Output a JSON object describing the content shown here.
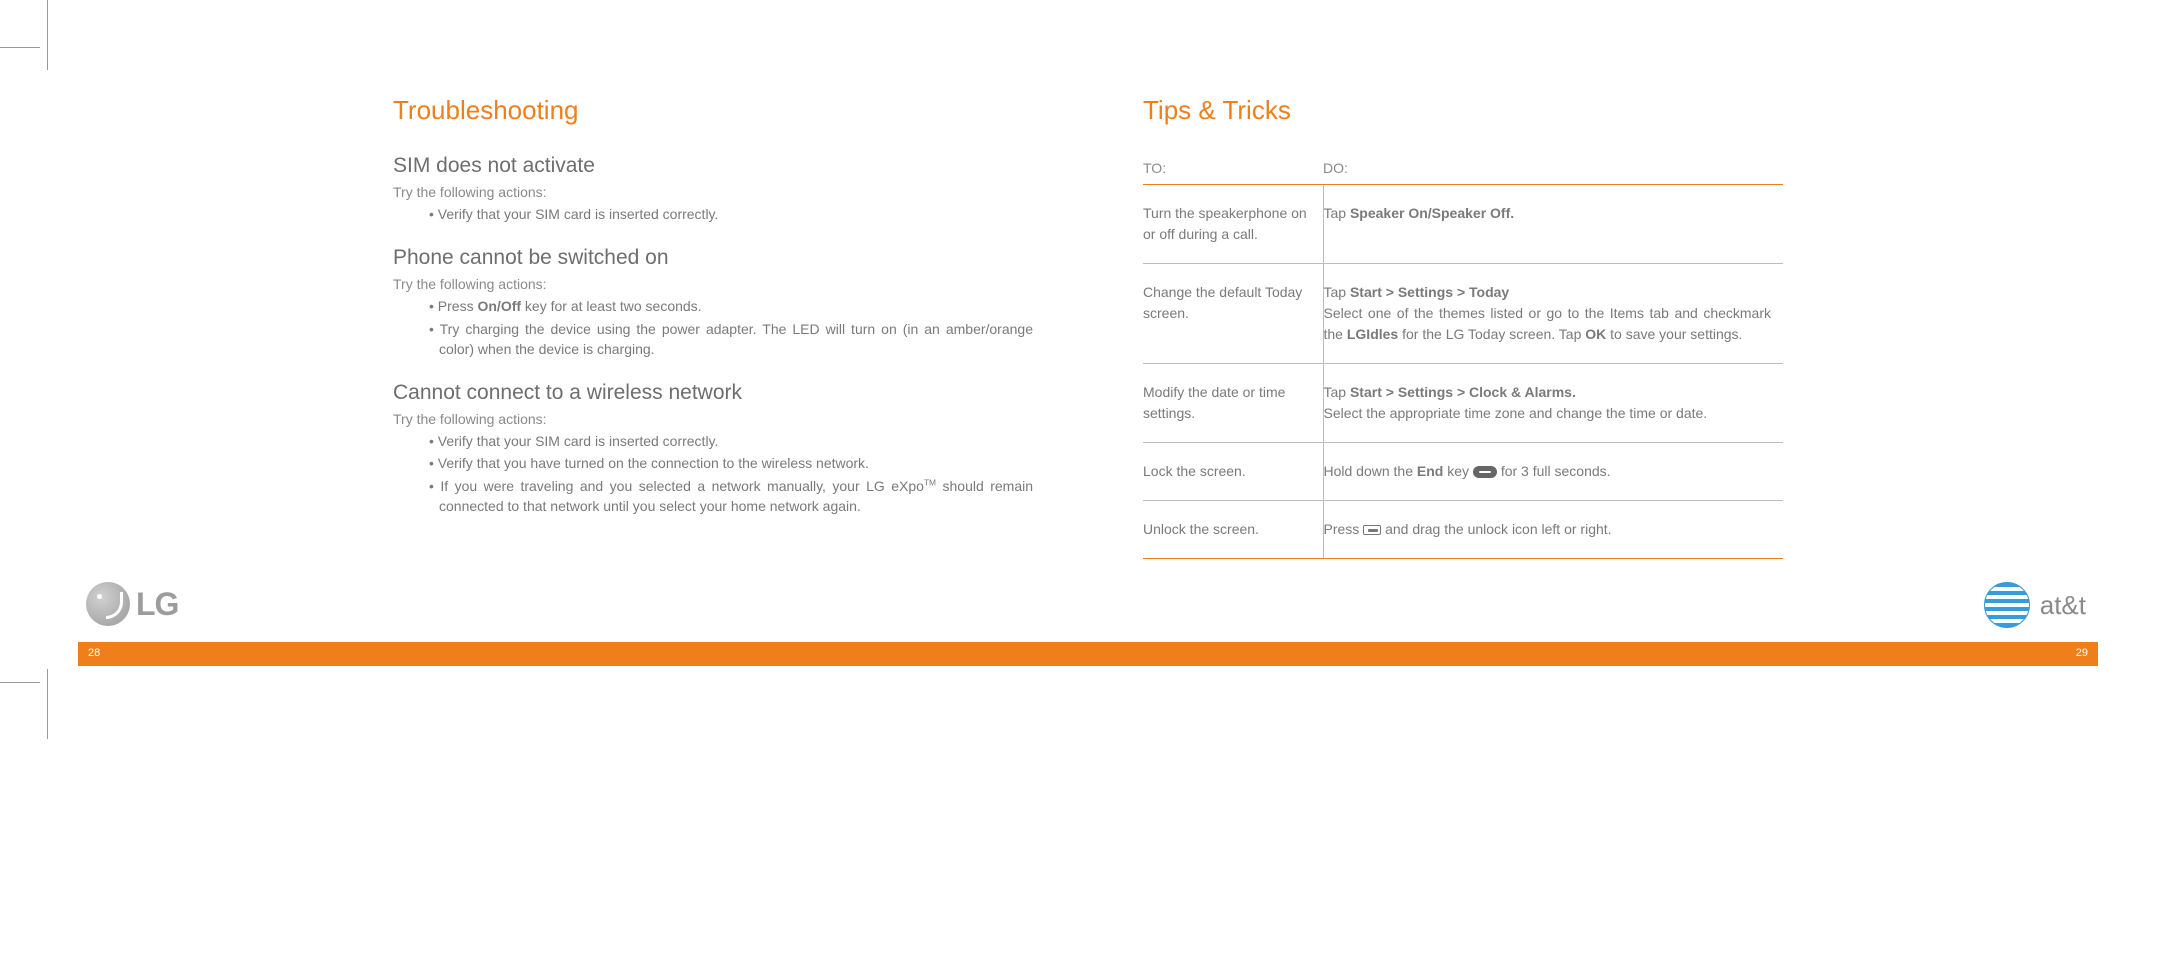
{
  "left": {
    "title": "Troubleshooting",
    "sections": [
      {
        "heading": "SIM does not activate",
        "intro": "Try the following actions:",
        "items": [
          "Verify that your SIM card is inserted correctly."
        ]
      },
      {
        "heading": "Phone cannot be switched on",
        "intro": "Try the following actions:",
        "items_html": [
          "Press <strong>On/Off</strong> key for at least two seconds.",
          "Try charging the device using the power adapter. The LED will turn on (in an amber/orange color) when the device is charging."
        ]
      },
      {
        "heading": "Cannot connect to a wireless network",
        "intro": "Try the following actions:",
        "items_html": [
          "Verify that your SIM card is inserted correctly.",
          "Verify that you have turned on the connection to the wireless network.",
          "If you were traveling and you selected a network manually, your LG eXpo<sup>TM</sup> should remain connected to that network until you select your home network again."
        ]
      }
    ],
    "page_num": "28"
  },
  "right": {
    "title": "Tips & Tricks",
    "table": {
      "header_to": "TO:",
      "header_do": "DO:",
      "rows": [
        {
          "to": "Turn the speakerphone on or off during a call.",
          "do_html": "Tap <strong>Speaker On/Speaker Off.</strong>"
        },
        {
          "to": "Change the default Today screen.",
          "do_html": "Tap <strong>Start > Settings > Today</strong><br>Select one of the themes listed or go to the Items tab and checkmark the <strong>LGIdles</strong> for the LG Today screen. Tap <strong>OK</strong> to save your settings."
        },
        {
          "to": "Modify the date or time settings.",
          "do_html": "Tap <strong>Start > Settings > Clock & Alarms.</strong><br>Select the appropriate time zone and change the time or date."
        },
        {
          "to": "Lock the screen.",
          "do_html": "Hold down the <strong>End</strong> key <span class='icon-key' data-name='end-key-icon' data-interactable='false'></span>  for 3 full seconds."
        },
        {
          "to": "Unlock the screen.",
          "do_html": "Press <span class='icon-btn' data-name='button-icon' data-interactable='false'></span> and drag the unlock icon left or right."
        }
      ]
    },
    "page_num": "29"
  },
  "logos": {
    "lg": "LG",
    "att": "at&t"
  }
}
